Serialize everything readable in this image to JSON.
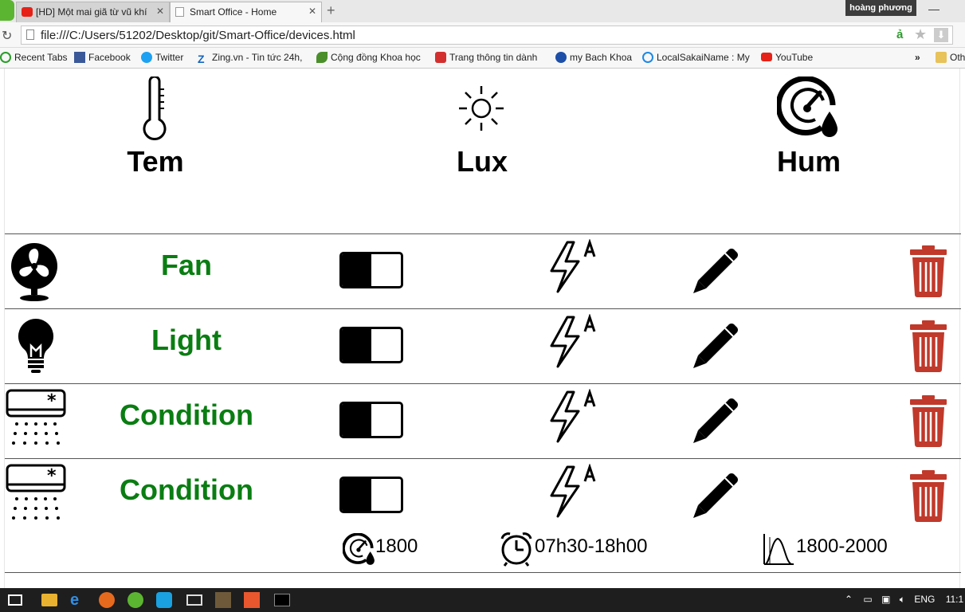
{
  "browser": {
    "tabs": [
      {
        "label": "[HD] Một mai giã từ vũ khí",
        "active": false
      },
      {
        "label": "Smart Office - Home",
        "active": true
      }
    ],
    "profile_name": "hoàng phương",
    "url": "file:///C:/Users/51202/Desktop/git/Smart-Office/devices.html",
    "bookmarks": [
      "Recent Tabs",
      "Facebook",
      "Twitter",
      "Zing.vn - Tin tức 24h,",
      "Cộng đồng Khoa học",
      "Trang thông tin dành",
      "my Bach Khoa",
      "LocalSakaiName : My",
      "YouTube"
    ],
    "bookmarks_overflow": "»",
    "other_bookmarks": "Oth"
  },
  "sensors": [
    {
      "label": "Tem",
      "icon": "thermometer-icon"
    },
    {
      "label": "Lux",
      "icon": "sun-icon"
    },
    {
      "label": "Hum",
      "icon": "humidity-gauge-icon"
    }
  ],
  "devices": [
    {
      "name": "Fan",
      "icon": "fan-icon",
      "switch_on": false
    },
    {
      "name": "Light",
      "icon": "lightbulb-icon",
      "switch_on": false
    },
    {
      "name": "Condition",
      "icon": "air-conditioner-icon",
      "switch_on": false
    },
    {
      "name": "Condition",
      "icon": "air-conditioner-icon",
      "switch_on": false
    }
  ],
  "device_info": {
    "value": "1800",
    "schedule": "07h30-18h00",
    "range": "1800-2000"
  },
  "colors": {
    "device_name": "#0a7d12",
    "delete_icon": "#c0392b"
  },
  "taskbar": {
    "language": "ENG",
    "time": "11:1"
  }
}
